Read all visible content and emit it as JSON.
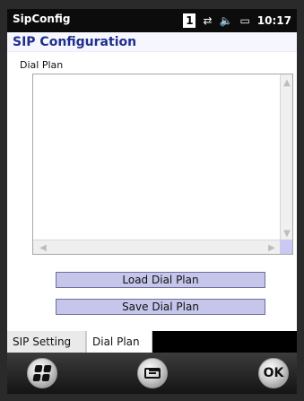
{
  "status_bar": {
    "app_title": "SipConfig",
    "sim_number": "1",
    "icons": [
      "sync-arrows-icon",
      "speaker-icon",
      "battery-icon"
    ],
    "time": "10:17"
  },
  "page": {
    "title": "SIP Configuration",
    "dial_plan_label": "Dial Plan"
  },
  "dial_plan_textarea": {
    "value": ""
  },
  "buttons": {
    "load": "Load Dial Plan",
    "save": "Save Dial Plan"
  },
  "tabs": [
    {
      "label": "SIP Setting",
      "selected": false
    },
    {
      "label": "Dial Plan",
      "selected": true
    }
  ],
  "softkeys": {
    "left_icon": "windows-start-icon",
    "center_icon": "keyboard-icon",
    "right_label": "OK"
  },
  "colors": {
    "title_text": "#1f2f8b",
    "button_fill": "#c6c5ea",
    "button_border": "#6f6f9d",
    "scroll_corner": "#c9c9f2"
  }
}
